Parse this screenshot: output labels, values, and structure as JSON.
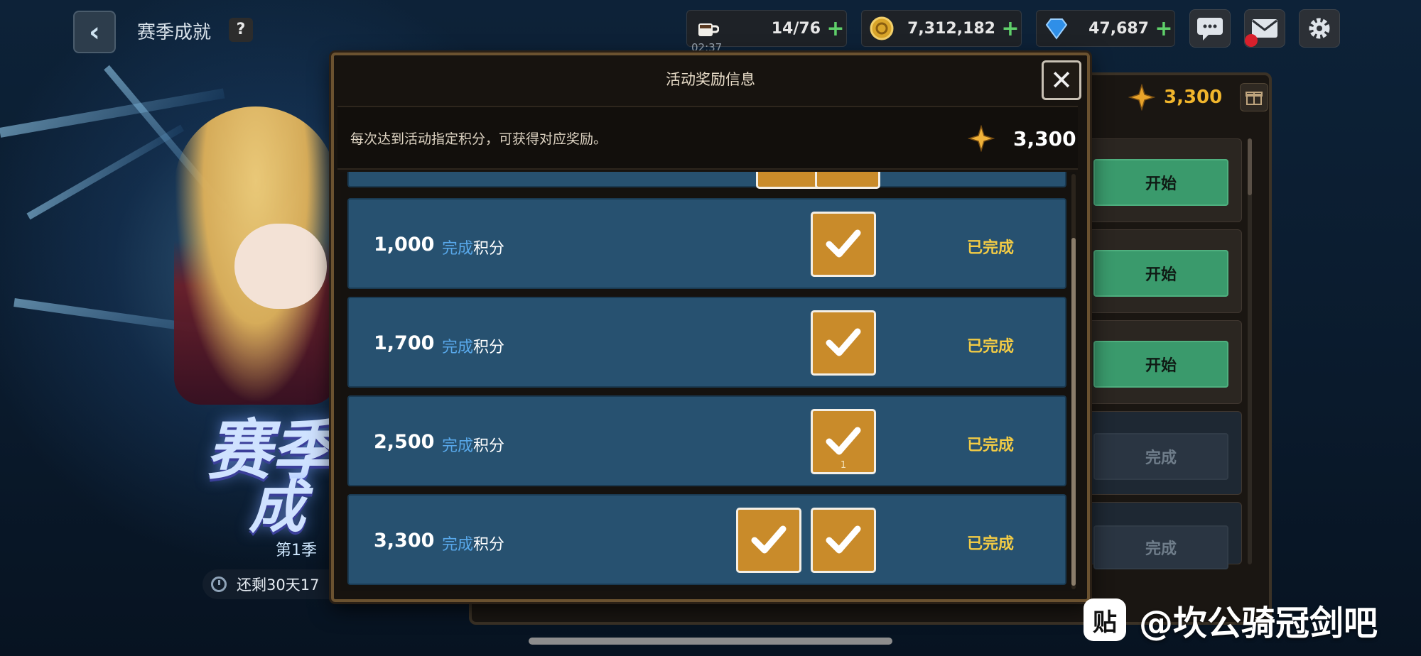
{
  "header": {
    "title": "赛季成就",
    "help_label": "?",
    "back_icon": "chevron-left-icon"
  },
  "resources": {
    "stamina": {
      "value": "14/76",
      "timer": "02:37",
      "icon": "coffee-cup-icon"
    },
    "gold": {
      "value": "7,312,182",
      "icon": "gold-coin-icon"
    },
    "gems": {
      "value": "47,687",
      "icon": "blue-gem-icon"
    },
    "plus_label": "+"
  },
  "background": {
    "banner_line1": "赛季",
    "banner_line2": "成",
    "season_label": "第1季",
    "time_left": "还剩30天17"
  },
  "right_panel": {
    "points": "3,300",
    "tasks": [
      {
        "button": "开始",
        "state": "start"
      },
      {
        "button": "开始",
        "state": "start"
      },
      {
        "button": "开始",
        "state": "start"
      },
      {
        "button": "完成",
        "state": "done"
      },
      {
        "button": "完成",
        "state": "done"
      }
    ]
  },
  "modal": {
    "title": "活动奖励信息",
    "close_label": "✕",
    "description": "每次达到活动指定积分，可获得对应奖励。",
    "current_points": "3,300",
    "rows": [
      {
        "points": "1,000",
        "label_highlight": "完成",
        "label_rest": "积分",
        "rewards": 1,
        "status": "已完成"
      },
      {
        "points": "1,700",
        "label_highlight": "完成",
        "label_rest": "积分",
        "rewards": 1,
        "status": "已完成"
      },
      {
        "points": "2,500",
        "label_highlight": "完成",
        "label_rest": "积分",
        "rewards": 1,
        "status": "已完成",
        "reward_count": "1"
      },
      {
        "points": "3,300",
        "label_highlight": "完成",
        "label_rest": "积分",
        "rewards": 2,
        "status": "已完成"
      }
    ]
  },
  "watermark": {
    "logo": "贴",
    "text": "@坎公骑冠剑吧"
  },
  "colors": {
    "row_bg": "#275170",
    "status_yellow": "#f2cb45",
    "highlight_blue": "#58a8ea",
    "reward_box": "#c98b2a",
    "modal_border": "#6b5230"
  }
}
